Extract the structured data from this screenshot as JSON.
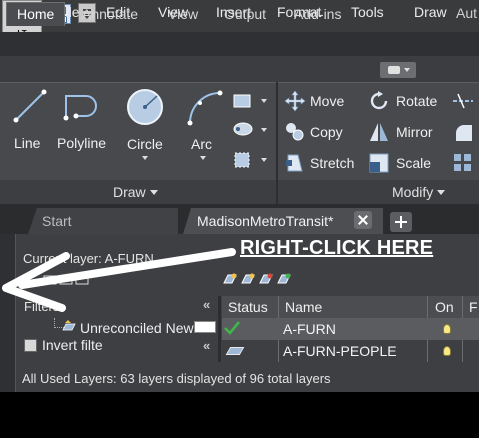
{
  "app": {
    "badge": "LT",
    "title": "Aut"
  },
  "menubar": {
    "items": [
      "File",
      "Edit",
      "View",
      "Insert",
      "Format",
      "Tools",
      "Draw"
    ]
  },
  "ribbon_tabs": [
    "Home",
    "Annotate",
    "View",
    "Output",
    "Add-ins"
  ],
  "ribbon": {
    "draw": {
      "panel_label": "Draw",
      "tools": [
        "Line",
        "Polyline",
        "Circle",
        "Arc"
      ]
    },
    "modify": {
      "panel_label": "Modify",
      "tools": [
        "Move",
        "Rotate",
        "Copy",
        "Mirror",
        "Stretch",
        "Scale"
      ]
    }
  },
  "file_tabs": {
    "start": "Start",
    "active": "MadisonMetroTransit*"
  },
  "layer_manager": {
    "current_layer": "Current layer: A-FURN",
    "filters_label": "Filters",
    "filter_item": "Unreconciled New",
    "invert_label": "Invert filte",
    "columns": [
      "Status",
      "Name",
      "On",
      "F"
    ],
    "rows": [
      {
        "name": "A-FURN"
      },
      {
        "name": "A-FURN-PEOPLE"
      }
    ],
    "status_line": "All Used Layers: 63 layers displayed of 96 total layers"
  },
  "annotation": {
    "callout": "RIGHT-CLICK HERE"
  },
  "colors": {
    "accent_red": "#c8201c",
    "selection_row": "#5a5c60",
    "check_green": "#3fb64a"
  }
}
